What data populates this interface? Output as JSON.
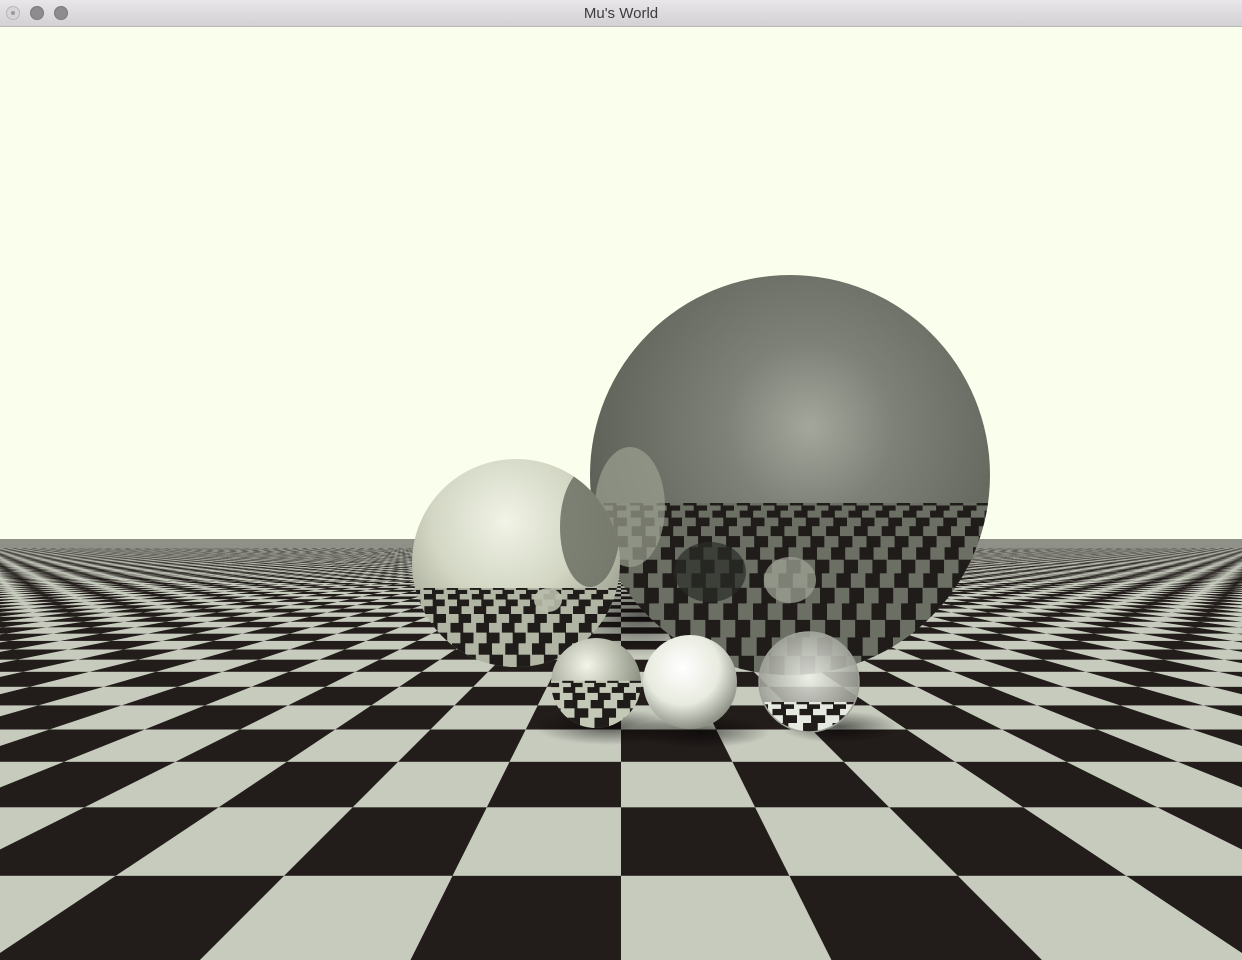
{
  "window": {
    "title": "Mu's World"
  },
  "colors": {
    "sky": "#f9ffec",
    "tile_dark": "#221c1a",
    "tile_light": "#c7cbbe",
    "chrome_sphere": "#d7dbc6",
    "steel_sphere": "#5e6259"
  }
}
